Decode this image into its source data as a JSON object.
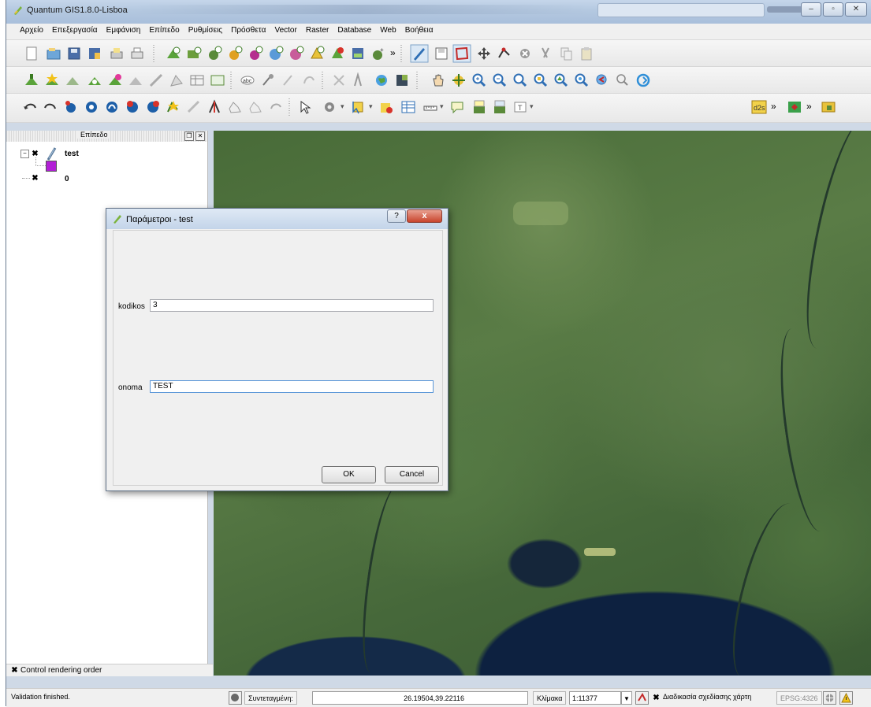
{
  "window": {
    "title": "Quantum GIS1.8.0-Lisboa"
  },
  "menu": [
    "Αρχείο",
    "Επεξεργασία",
    "Εμφάνιση",
    "Επίπεδο",
    "Ρυθμίσεις",
    "Πρόσθετα",
    "Vector",
    "Raster",
    "Database",
    "Web",
    "Βοήθεια"
  ],
  "toolbar_more": "»",
  "layers_panel": {
    "title": "Επίπεδο",
    "layers": [
      {
        "name": "test",
        "checked": true
      },
      {
        "name": "0",
        "checked": true
      }
    ],
    "control_rendering_order": "Control rendering order"
  },
  "dialog": {
    "title": "Παράμετροι - test",
    "help": "?",
    "close": "x",
    "fields": [
      {
        "label": "kodikos",
        "value": "3"
      },
      {
        "label": "onoma",
        "value": "TEST"
      }
    ],
    "ok_label": "OK",
    "cancel_label": "Cancel"
  },
  "statusbar": {
    "message": "Validation finished.",
    "coord_label": "Συντεταγμένη:",
    "coord_value": "26.19504,39.22116",
    "scale_label": "Κλίμακα",
    "scale_value": "1:11377",
    "render_label": "Διαδικασία σχεδίασης χάρτη",
    "crs": "EPSG:4326"
  },
  "colors": {
    "layer_swatch": "#b21fd6",
    "accent": "#c9442c"
  }
}
